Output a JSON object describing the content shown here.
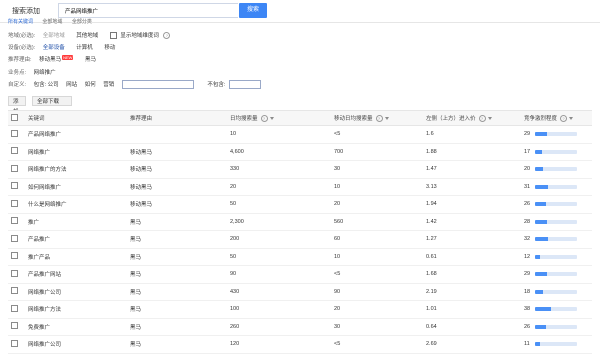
{
  "header": {
    "title": "搜索添加",
    "search_value": "产品网络推广",
    "search_button": "搜索"
  },
  "tabs": [
    {
      "label": "所有关键词",
      "active": true
    },
    {
      "label": "全部地域",
      "active": false
    },
    {
      "label": "全部分类",
      "active": false
    }
  ],
  "filters": {
    "region": {
      "label": "地域(必选):",
      "options": [
        {
          "text": "全部地域",
          "state": "muted"
        },
        {
          "text": "其他地域",
          "state": "normal"
        }
      ],
      "checkbox_label": "显示地域维度词"
    },
    "device": {
      "label": "设备(必选):",
      "options": [
        "全部设备",
        "计算机",
        "移动"
      ]
    },
    "recommend": {
      "label": "推荐理由:",
      "options": [
        {
          "text": "移动黑马",
          "new": "NEW"
        },
        {
          "text": "黑马"
        }
      ]
    },
    "business": {
      "label": "业务点:",
      "value": "网络推广"
    },
    "custom": {
      "label": "自定义:",
      "contains_label": "包含:",
      "contains_options": [
        "公司",
        "网站",
        "如何",
        "营销"
      ],
      "exclude_label": "不包含:"
    }
  },
  "actions": {
    "add": "添加",
    "download_all": "全部下载"
  },
  "table": {
    "headers": [
      "关键词",
      "推荐理由",
      "日均搜索量",
      "移动日均搜索量",
      "左侧（上方）进入价",
      "竞争激烈程度"
    ],
    "rows": [
      {
        "keyword": "产品网络推广",
        "reason": "",
        "daily": "10",
        "mobile": "<5",
        "price": "1.6",
        "competition": "29",
        "comp_value": 29
      },
      {
        "keyword": "网络推广",
        "reason": "移动黑马",
        "daily": "4,600",
        "mobile": "700",
        "price": "1.88",
        "competition": "17",
        "comp_value": 17
      },
      {
        "keyword": "网络推广的方法",
        "reason": "移动黑马",
        "daily": "330",
        "mobile": "30",
        "price": "1.47",
        "competition": "20",
        "comp_value": 20
      },
      {
        "keyword": "如何网络推广",
        "reason": "移动黑马",
        "daily": "20",
        "mobile": "10",
        "price": "3.13",
        "competition": "31",
        "comp_value": 31
      },
      {
        "keyword": "什么是网络推广",
        "reason": "移动黑马",
        "daily": "50",
        "mobile": "20",
        "price": "1.94",
        "competition": "26",
        "comp_value": 26
      },
      {
        "keyword": "推广",
        "reason": "黑马",
        "daily": "2,300",
        "mobile": "560",
        "price": "1.42",
        "competition": "28",
        "comp_value": 28
      },
      {
        "keyword": "产品推广",
        "reason": "黑马",
        "daily": "200",
        "mobile": "60",
        "price": "1.27",
        "competition": "32",
        "comp_value": 32
      },
      {
        "keyword": "推广产品",
        "reason": "黑马",
        "daily": "50",
        "mobile": "10",
        "price": "0.61",
        "competition": "12",
        "comp_value": 12
      },
      {
        "keyword": "产品推广网站",
        "reason": "黑马",
        "daily": "90",
        "mobile": "<5",
        "price": "1.68",
        "competition": "29",
        "comp_value": 29
      },
      {
        "keyword": "网络推广公司",
        "reason": "黑马",
        "daily": "430",
        "mobile": "90",
        "price": "2.19",
        "competition": "18",
        "comp_value": 18
      },
      {
        "keyword": "网络推广方法",
        "reason": "黑马",
        "daily": "100",
        "mobile": "20",
        "price": "1.01",
        "competition": "38",
        "comp_value": 38
      },
      {
        "keyword": "免费推广",
        "reason": "黑马",
        "daily": "260",
        "mobile": "30",
        "price": "0.64",
        "competition": "26",
        "comp_value": 26
      },
      {
        "keyword": "网络推广公司",
        "reason": "黑马",
        "daily": "120",
        "mobile": "<5",
        "price": "2.69",
        "competition": "11",
        "comp_value": 11
      }
    ]
  },
  "colors": {
    "accent": "#3d86f5",
    "bar_bg": "#dce7f7",
    "bar_fill": "#4a90f6"
  }
}
